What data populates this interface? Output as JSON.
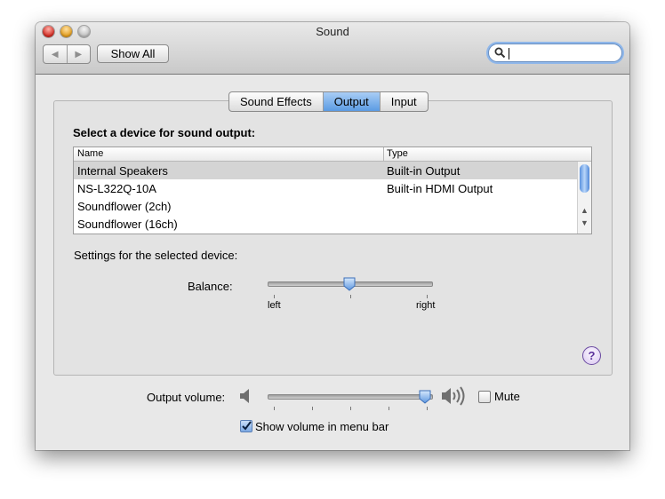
{
  "window": {
    "title": "Sound"
  },
  "toolbar": {
    "show_all_label": "Show All",
    "search": {
      "value": "",
      "placeholder": ""
    }
  },
  "tabs": [
    {
      "label": "Sound Effects",
      "active": false
    },
    {
      "label": "Output",
      "active": true
    },
    {
      "label": "Input",
      "active": false
    }
  ],
  "output": {
    "select_label": "Select a device for sound output:",
    "columns": [
      "Name",
      "Type"
    ],
    "devices": [
      {
        "name": "Internal Speakers",
        "type": "Built-in Output",
        "selected": true
      },
      {
        "name": "NS-L322Q-10A",
        "type": "Built-in HDMI Output",
        "selected": false
      },
      {
        "name": "Soundflower (2ch)",
        "type": "",
        "selected": false
      },
      {
        "name": "Soundflower (16ch)",
        "type": "",
        "selected": false
      }
    ],
    "settings_label": "Settings for the selected device:",
    "balance": {
      "label": "Balance:",
      "left_label": "left",
      "right_label": "right",
      "value": 0.5
    }
  },
  "help": {
    "glyph": "?"
  },
  "volume": {
    "label": "Output volume:",
    "value": 1.0,
    "mute_label": "Mute",
    "mute_checked": false,
    "show_in_menu_label": "Show volume in menu bar",
    "show_in_menu_checked": true
  },
  "colors": {
    "accent": "#5b9be3",
    "selection": "#d4d4d4"
  }
}
